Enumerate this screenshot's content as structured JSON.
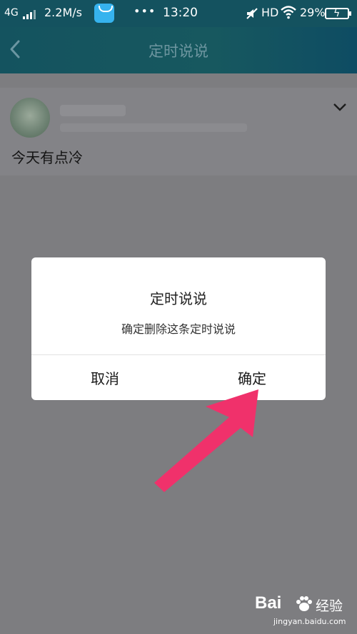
{
  "status_bar": {
    "network": "4G",
    "speed": "2.2M/s",
    "dots": "•••",
    "time": "13:20",
    "hd": "HD",
    "battery_pct": "29%",
    "icons": [
      "signal-icon",
      "app-store-icon",
      "mute-icon",
      "wifi-icon",
      "battery-charging-icon"
    ]
  },
  "header": {
    "title": "定时说说",
    "back_icon": "back-arrow-icon"
  },
  "post": {
    "text": "今天有点冷",
    "expand_icon": "chevron-down-icon"
  },
  "dialog": {
    "title": "定时说说",
    "message": "确定删除这条定时说说",
    "cancel_label": "取消",
    "confirm_label": "确定"
  },
  "annotation": {
    "arrow_color": "#f0316b"
  },
  "watermark": {
    "brand": "Bai",
    "brand_cn": "经验",
    "url": "jingyan.baidu.com"
  },
  "colors": {
    "status_bar": "#14525f",
    "overlay": "#7d7d80",
    "dialog_bg": "#ffffff"
  }
}
